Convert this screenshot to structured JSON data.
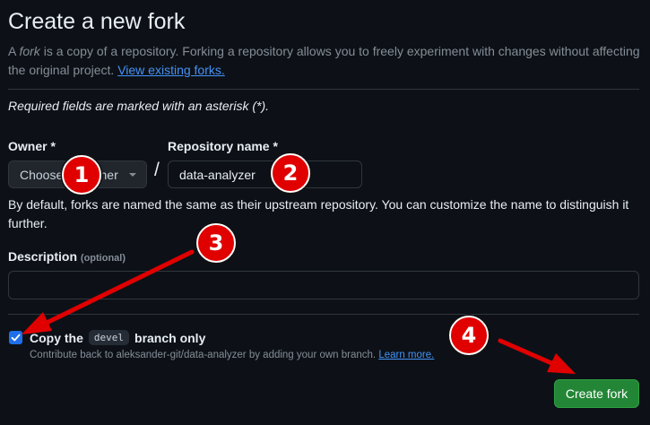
{
  "page": {
    "title": "Create a new fork",
    "description_prefix": "A ",
    "description_em": "fork",
    "description_rest": " is a copy of a repository. Forking a repository allows you to freely experiment with changes without affecting the original project. ",
    "view_forks_link": "View existing forks.",
    "required_note": "Required fields are marked with an asterisk (*)."
  },
  "form": {
    "owner_label": "Owner *",
    "owner_value": "Choose an owner",
    "slash": "/",
    "repo_label": "Repository name *",
    "repo_value": "data-analyzer",
    "hint": "By default, forks are named the same as their upstream repository. You can customize the name to distinguish it further.",
    "description_label": "Description",
    "description_optional": "(optional)",
    "description_value": "",
    "copy_prefix": "Copy the",
    "copy_branch": "devel",
    "copy_suffix": "branch only",
    "copy_checked": true,
    "contribute_text": "Contribute back to aleksander-git/data-analyzer by adding your own branch. ",
    "learn_more": "Learn more.",
    "create_button": "Create fork"
  },
  "annotations": {
    "markers": [
      "1",
      "2",
      "3",
      "4"
    ],
    "marker_color": "#e00000"
  },
  "colors": {
    "background": "#0d1117",
    "accent_link": "#4493f8",
    "primary_button": "#238636",
    "checkbox": "#1f6feb"
  }
}
